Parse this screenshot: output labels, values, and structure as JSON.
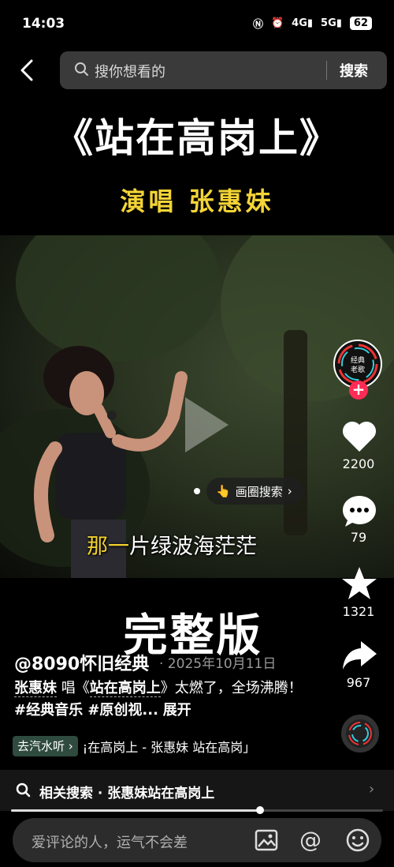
{
  "status_bar": {
    "time": "14:03",
    "network_1": "4G",
    "network_2": "5G",
    "battery": "62"
  },
  "search": {
    "placeholder": "搜你想看的",
    "button": "搜索"
  },
  "video": {
    "title": "《站在高岗上》",
    "singer_line": "演唱 张惠妹",
    "subtitle_highlight": "那一",
    "subtitle_rest": "片绿波海茫茫",
    "circle_search": "画圈搜索",
    "big_text": "完整版"
  },
  "rail": {
    "avatar_text_1": "经典",
    "avatar_text_2": "老歌",
    "likes": "2200",
    "comments": "79",
    "favorites": "1321",
    "shares": "967"
  },
  "post": {
    "author": "@8090怀旧经典",
    "date": "· 2025年10月11日",
    "caption_singer": "张惠妹",
    "caption_sing": " 唱《",
    "caption_song": "站在高岗上",
    "caption_rest": "》太燃了，全场沸腾！",
    "tags": "#经典音乐 #原创视...",
    "expand": "展开",
    "qishui_label": "去汽水听",
    "music": "¡在高岗上 - 张惠妹   站在高岗」"
  },
  "related": {
    "text": "相关搜索 · 张惠妹站在高岗上"
  },
  "progress": {
    "fraction": 0.67
  },
  "comment_bar": {
    "placeholder": "爱评论的人，运气不会差"
  },
  "colors": {
    "accent_red": "#fe2c55",
    "title_yellow": "#f4d436"
  }
}
